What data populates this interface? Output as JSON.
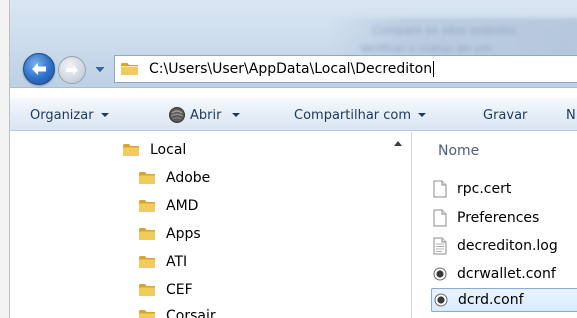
{
  "address_bar": {
    "path": "C:\\Users\\User\\AppData\\Local\\Decrediton"
  },
  "background_window": {
    "line1": "Compare os sites exibidos",
    "line2": "Verificar o status de um"
  },
  "toolbar": {
    "organize_label": "Organizar",
    "open_label": "Abrir",
    "share_label": "Compartilhar com",
    "burn_label": "Gravar",
    "overflow_label": "N"
  },
  "nav_tree": {
    "parent": {
      "label": "Local",
      "icon": "folder-icon"
    },
    "children": [
      {
        "label": "Adobe",
        "icon": "folder-icon"
      },
      {
        "label": "AMD",
        "icon": "folder-icon"
      },
      {
        "label": "Apps",
        "icon": "folder-icon"
      },
      {
        "label": "ATI",
        "icon": "folder-icon"
      },
      {
        "label": "CEF",
        "icon": "folder-icon"
      },
      {
        "label": "Corsair",
        "icon": "folder-icon"
      }
    ]
  },
  "file_list": {
    "column_header": "Nome",
    "items": [
      {
        "name": "rpc.cert",
        "icon": "document-icon",
        "selected": false
      },
      {
        "name": "Preferences",
        "icon": "document-icon",
        "selected": false
      },
      {
        "name": "decrediton.log",
        "icon": "text-document-icon",
        "selected": false
      },
      {
        "name": "dcrwallet.conf",
        "icon": "config-file-icon",
        "selected": false
      },
      {
        "name": "dcrd.conf",
        "icon": "config-file-icon",
        "selected": true
      }
    ]
  },
  "colors": {
    "toolbar_text": "#1e395b",
    "selection_border": "#84acdd",
    "folder_yellow": "#e8b93c"
  }
}
